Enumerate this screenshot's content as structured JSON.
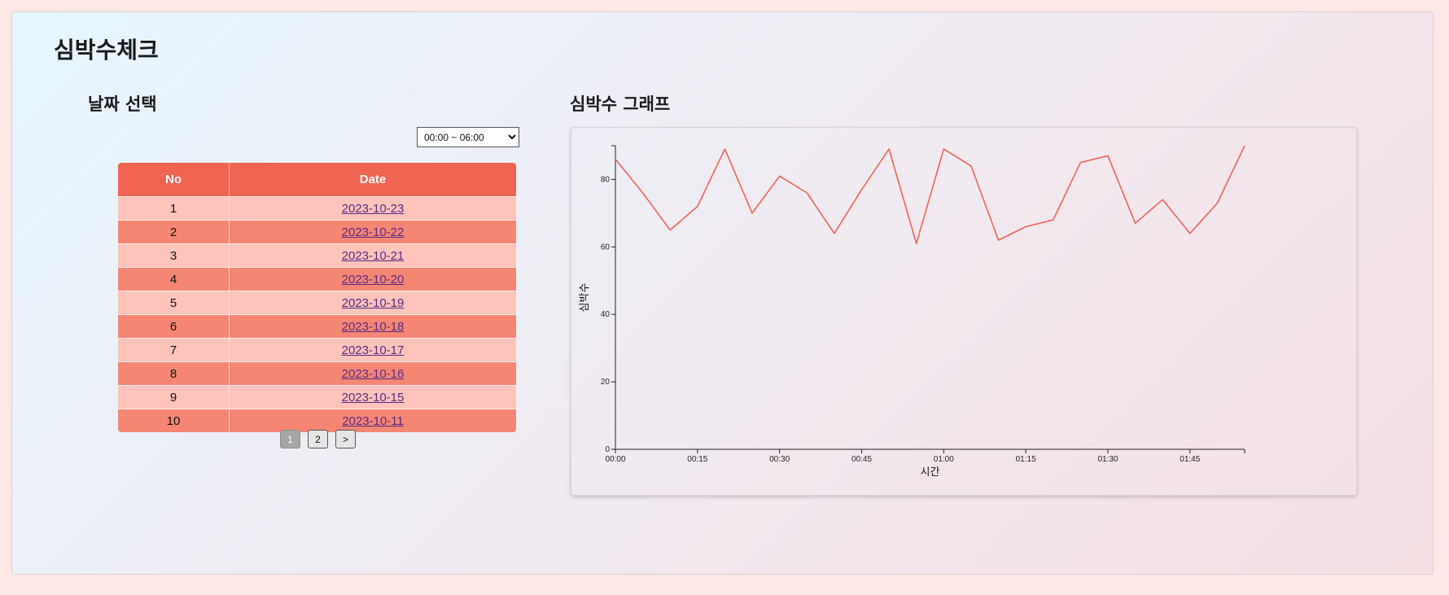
{
  "page": {
    "title": "심박수체크"
  },
  "date_section": {
    "title": "날짜 선택",
    "time_range": {
      "selected": "00:00 ~ 06:00",
      "options": [
        "00:00 ~ 06:00"
      ]
    },
    "table": {
      "headers": [
        "No",
        "Date"
      ],
      "rows": [
        {
          "no": "1",
          "date": "2023-10-23"
        },
        {
          "no": "2",
          "date": "2023-10-22"
        },
        {
          "no": "3",
          "date": "2023-10-21"
        },
        {
          "no": "4",
          "date": "2023-10-20"
        },
        {
          "no": "5",
          "date": "2023-10-19"
        },
        {
          "no": "6",
          "date": "2023-10-18"
        },
        {
          "no": "7",
          "date": "2023-10-17"
        },
        {
          "no": "8",
          "date": "2023-10-16"
        },
        {
          "no": "9",
          "date": "2023-10-15"
        },
        {
          "no": "10",
          "date": "2023-10-11"
        }
      ]
    },
    "pagination": {
      "pages": [
        "1",
        "2"
      ],
      "active": "1",
      "next_label": ">"
    }
  },
  "graph_section": {
    "title": "심박수 그래프"
  },
  "chart_data": {
    "type": "line",
    "title": "",
    "xlabel": "시간",
    "ylabel": "심박수",
    "ylim": [
      0,
      90
    ],
    "y_ticks": [
      0,
      20,
      40,
      60,
      80
    ],
    "x_tick_labels": [
      "00:00",
      "00:15",
      "00:30",
      "00:45",
      "01:00",
      "01:15",
      "01:30",
      "01:45"
    ],
    "x_minutes_range": [
      0,
      115
    ],
    "line_color": "#f06452",
    "series": [
      {
        "x": [
          "00:00",
          "00:05",
          "00:10",
          "00:15",
          "00:20",
          "00:25",
          "00:30",
          "00:35",
          "00:40",
          "00:45",
          "00:50",
          "00:55",
          "01:00",
          "01:05",
          "01:10",
          "01:15",
          "01:20",
          "01:25",
          "01:30",
          "01:35",
          "01:40",
          "01:45",
          "01:50",
          "01:55"
        ],
        "values": [
          86,
          76,
          65,
          72,
          89,
          70,
          81,
          76,
          64,
          77,
          89,
          61,
          89,
          84,
          62,
          66,
          68,
          85,
          87,
          67,
          74,
          64,
          73,
          90
        ]
      }
    ]
  }
}
